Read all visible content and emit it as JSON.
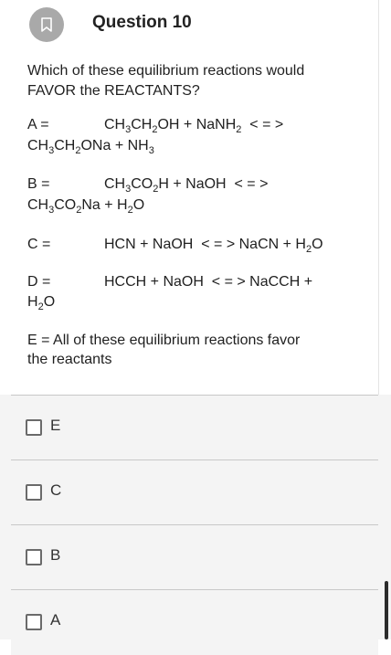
{
  "question": {
    "title": "Question 10",
    "prompt_line1": "Which of these equilibrium reactions would",
    "prompt_line2": "FAVOR the REACTANTS?"
  },
  "reactions": {
    "a": {
      "label": "A =",
      "line1": [
        "CH",
        "3",
        "CH",
        "2",
        "OH + NaNH",
        "2",
        "  < = >"
      ],
      "line2": [
        "CH",
        "3",
        "CH",
        "2",
        "ONa + NH",
        "3"
      ]
    },
    "b": {
      "label": "B =",
      "line1": [
        "CH",
        "3",
        "CO",
        "2",
        "H + NaOH  < = >"
      ],
      "line2": [
        "CH",
        "3",
        "CO",
        "2",
        "Na + H",
        "2",
        "O"
      ]
    },
    "c": {
      "label": "C =",
      "line1": [
        "HCN + NaOH  < = > NaCN + H",
        "2",
        "O"
      ]
    },
    "d": {
      "label": "D =",
      "line1": [
        "HCCH + NaOH  < = > NaCCH +"
      ],
      "line2": [
        "H",
        "2",
        "O"
      ]
    },
    "e": {
      "line1": "E = All of these equilibrium reactions favor",
      "line2": "the reactants"
    }
  },
  "options": [
    {
      "label": "E"
    },
    {
      "label": "C"
    },
    {
      "label": "B"
    },
    {
      "label": "A"
    }
  ],
  "icons": {
    "bookmark": "bookmark-icon",
    "checkbox": "checkbox-icon"
  },
  "colors": {
    "bookmark_bg": "#a9a9a9",
    "options_bg": "#f4f4f4",
    "divider": "#c8c8c8"
  }
}
